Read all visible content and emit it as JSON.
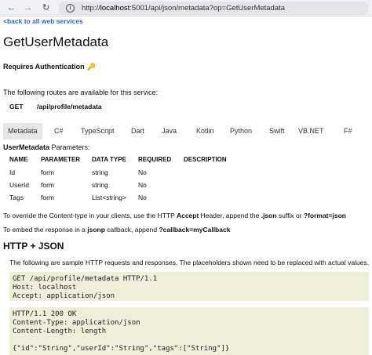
{
  "browser": {
    "url_prefix": "http://",
    "url_host": "localhost",
    "url_rest": ":5001/api/json/metadata?op=GetUserMetadata"
  },
  "page": {
    "back_link": "<back to all web services",
    "title": "GetUserMetadata",
    "auth_label": "Requires Authentication",
    "auth_icon": "key-icon",
    "routes_intro": "The following routes are available for this service:",
    "route": {
      "verb": "GET",
      "path": "/api/profile/metadata"
    }
  },
  "tabs": [
    {
      "label": "Metadata",
      "active": true
    },
    {
      "label": "C#"
    },
    {
      "label": "TypeScript"
    },
    {
      "label": "Dart"
    },
    {
      "label": "Java"
    },
    {
      "label": "Kotlin"
    },
    {
      "label": "Python"
    },
    {
      "label": "Swift"
    },
    {
      "label": "VB.NET"
    },
    {
      "label": "F#"
    }
  ],
  "params": {
    "type_name": "UserMetadata",
    "suffix": " Parameters:",
    "headers": [
      "NAME",
      "PARAMETER",
      "DATA TYPE",
      "REQUIRED",
      "DESCRIPTION"
    ],
    "rows": [
      [
        "Id",
        "form",
        "string",
        "No",
        ""
      ],
      [
        "UserId",
        "form",
        "string",
        "No",
        ""
      ],
      [
        "Tags",
        "form",
        "List<string>",
        "No",
        ""
      ]
    ]
  },
  "notes": {
    "content_type": {
      "pre": "To override the Content-type in your clients, use the HTTP ",
      "b1": "Accept",
      "mid1": " Header, append the ",
      "b2": ".json",
      "mid2": " suffix or ",
      "b3": "?format=json"
    },
    "jsonp": {
      "pre": "To embed the response in a ",
      "b1": "jsonp",
      "mid": " callback, append ",
      "b2": "?callback=myCallback"
    }
  },
  "http_json": {
    "title": "HTTP + JSON",
    "intro": "The following are sample HTTP requests and responses. The placeholders shown need to be replaced with actual values.",
    "request": "GET /api/profile/metadata HTTP/1.1\nHost: localhost\nAccept: application/json",
    "response": "HTTP/1.1 200 OK\nContent-Type: application/json\nContent-Length: length\n\n{\"id\":\"String\",\"userId\":\"String\",\"tags\":[\"String\"]}"
  }
}
